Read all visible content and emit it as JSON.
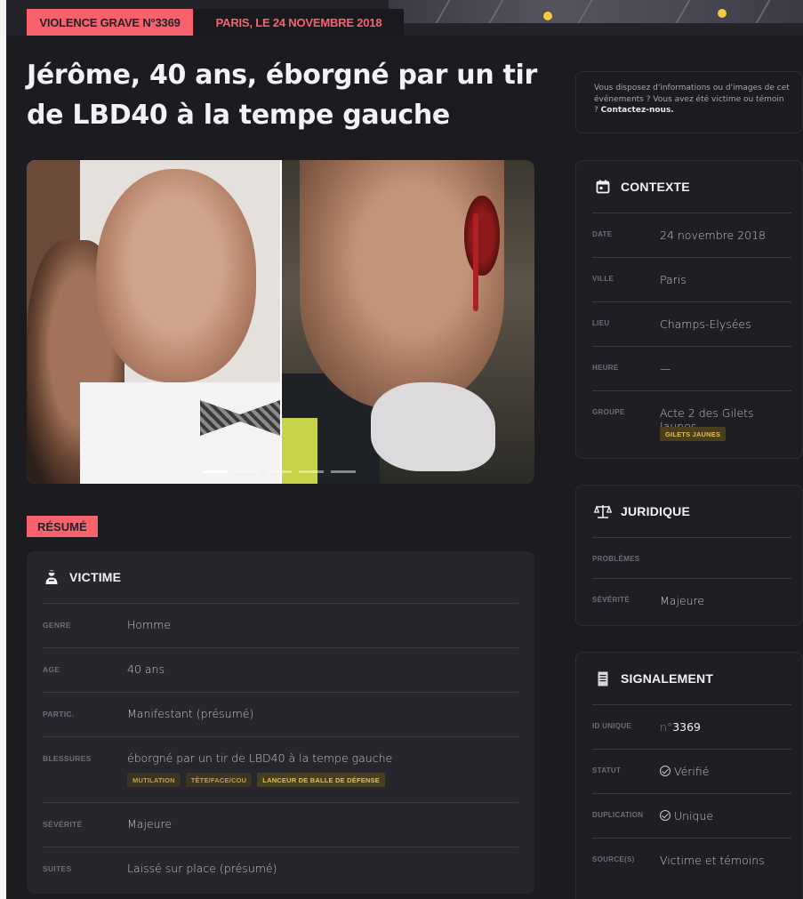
{
  "header": {
    "violence_tag": "VIOLENCE GRAVE N°3369",
    "date_tag": "PARIS, LE 24 NOVEMBRE 2018"
  },
  "title": "Jérôme, 40 ans, éborgné par un tir de LBD40 à la tempe gauche",
  "carousel": {
    "slide_count": 5,
    "active_index": 0
  },
  "resume_label": "RÉSUMÉ",
  "victime": {
    "heading": "VICTIME",
    "icon": "person-icon",
    "rows": [
      {
        "key": "GENRE",
        "value": "Homme"
      },
      {
        "key": "AGE",
        "value": "40 ans"
      },
      {
        "key": "PARTIC.",
        "value": "Manifestant (présumé)"
      },
      {
        "key": "BLESSURES",
        "value": "éborgné par un tir de LBD40 à la tempe gauche",
        "chips": [
          "MUTILATION",
          "TÊTE/FACE/COU",
          "LANCEUR DE BALLE DE DÉFENSE"
        ]
      },
      {
        "key": "SÉVÉRITÉ",
        "value": "Majeure"
      },
      {
        "key": "SUITES",
        "value": "Laissé sur place (présumé)"
      }
    ]
  },
  "info_box": {
    "text": "Vous disposez d'informations ou d'images de cet événements ? Vous avez été victime ou témoin ?",
    "link": "Contactez-nous."
  },
  "contexte": {
    "heading": "CONTEXTE",
    "icon": "calendar-icon",
    "rows": [
      {
        "key": "DATE",
        "value": "24 novembre 2018"
      },
      {
        "key": "VILLE",
        "value": "Paris"
      },
      {
        "key": "LIEU",
        "value": "Champs-Elysées"
      },
      {
        "key": "HEURE",
        "value": "—"
      },
      {
        "key": "GROUPE",
        "value": "Acte 2 des Gilets Jaunes",
        "chip": "GILETS JAUNES"
      }
    ]
  },
  "juridique": {
    "heading": "JURIDIQUE",
    "icon": "scales-icon",
    "rows": [
      {
        "key": "PROBLÈMES",
        "value": ""
      },
      {
        "key": "SÉVÉRITÉ",
        "value": "Majeure"
      }
    ]
  },
  "signalement": {
    "heading": "SIGNALEMENT",
    "icon": "document-icon",
    "rows": [
      {
        "key": "ID UNIQUE",
        "prefix": "n°",
        "value": "3369"
      },
      {
        "key": "STATUT",
        "value": "Vérifié"
      },
      {
        "key": "DUPLICATION",
        "value": "Unique"
      },
      {
        "key": "SOURCE(S)",
        "value": "Victime et témoins"
      }
    ]
  },
  "colors": {
    "accent": "#f8626d",
    "background": "#1c1b20",
    "card": "#27262c",
    "chip_text": "#c2a24a"
  }
}
